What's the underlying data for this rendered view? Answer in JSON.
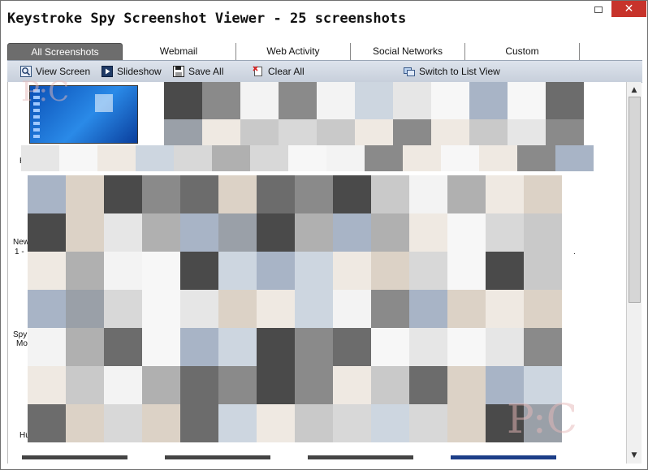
{
  "window": {
    "title": "Keystroke Spy Screenshot Viewer - 25 screenshots",
    "close_glyph": "✕"
  },
  "tabs": [
    {
      "label": "All Screenshots",
      "active": true
    },
    {
      "label": "Webmail",
      "active": false
    },
    {
      "label": "Web Activity",
      "active": false
    },
    {
      "label": "Social Networks",
      "active": false
    },
    {
      "label": "Custom",
      "active": false
    }
  ],
  "toolbar": {
    "view_screen": "View Screen",
    "slideshow": "Slideshow",
    "save_all": "Save All",
    "clear_all": "Clear All",
    "switch_view": "Switch to List View"
  },
  "screenshots": {
    "label_1": "H",
    "label_2a": "New",
    "label_2b": "1 -",
    "label_3a": "Spy",
    "label_3b": "Mo",
    "label_4": "Hu",
    "label_dot": "."
  },
  "watermarks": {
    "top": "P:C",
    "bottom": "P:C"
  },
  "colors": {
    "accent_active_tab": "#6d6d6d",
    "close_button": "#c7332b",
    "toolbar": "#c7cfdb"
  }
}
